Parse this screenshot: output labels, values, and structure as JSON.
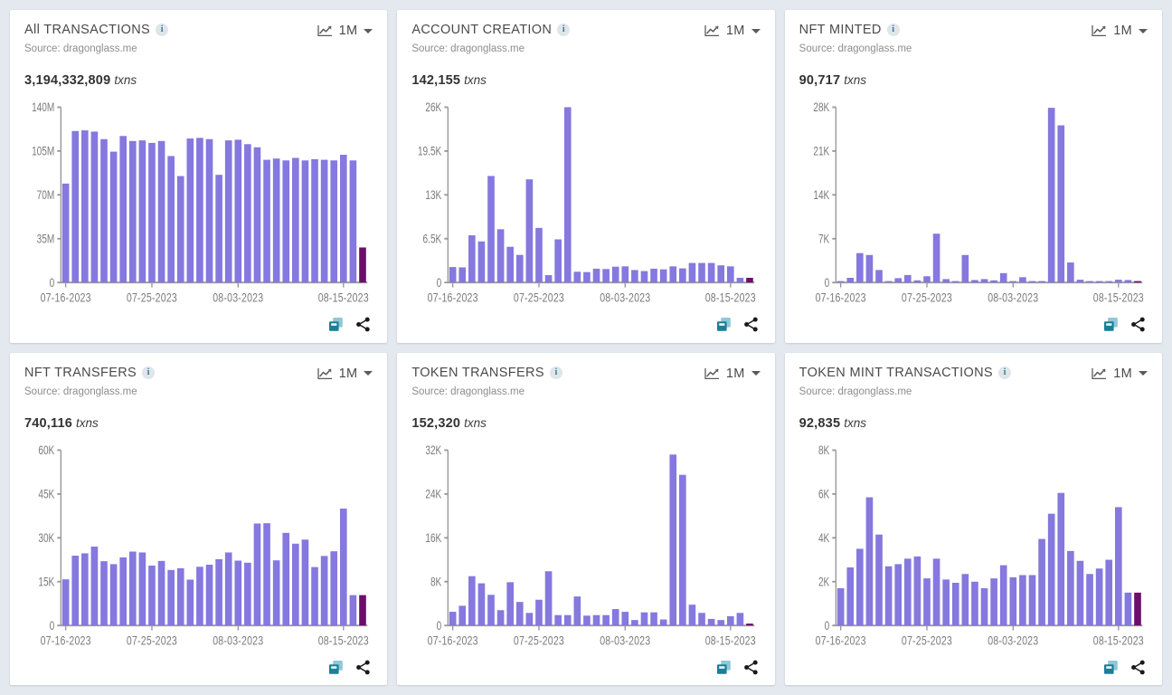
{
  "theme": {
    "page_bg": "#e4e9f0",
    "card_bg": "#ffffff",
    "bar_color": "#8578de",
    "bar_highlight_color": "#6b0f6b",
    "axis_color": "#9a9a9a",
    "tick_text_color": "#7b7b7b",
    "info_icon_color": "#2a7f9e",
    "copy_icon_color": "#1c7f96",
    "share_icon_color": "#1a1a1a"
  },
  "common": {
    "source_label": "Source: dragonglass.me",
    "range_label": "1M",
    "unit_label": "txns",
    "info_glyph": "i",
    "icons": {
      "info": "info-icon",
      "chart_type": "line-chart-icon",
      "dropdown": "chevron-down-icon",
      "copy": "copy-icon",
      "share": "share-icon"
    }
  },
  "cards": [
    {
      "id": "all-transactions",
      "title": "All TRANSACTIONS",
      "source": "Source: dragonglass.me",
      "total": "3,194,332,809",
      "unit": "txns",
      "range": "1M",
      "chart_data": {
        "type": "bar",
        "title": "All TRANSACTIONS",
        "xlabel": "",
        "ylabel": "",
        "ylim": [
          0,
          140000000
        ],
        "yticks": [
          0,
          35000000,
          70000000,
          105000000,
          140000000
        ],
        "ytick_labels": [
          "0",
          "35M",
          "70M",
          "105M",
          "140M"
        ],
        "grid": false,
        "legend": "none",
        "x": [
          "07-16-2023",
          "07-17-2023",
          "07-18-2023",
          "07-19-2023",
          "07-20-2023",
          "07-21-2023",
          "07-22-2023",
          "07-23-2023",
          "07-24-2023",
          "07-25-2023",
          "07-26-2023",
          "07-27-2023",
          "07-28-2023",
          "07-29-2023",
          "07-30-2023",
          "07-31-2023",
          "08-01-2023",
          "08-02-2023",
          "08-03-2023",
          "08-04-2023",
          "08-05-2023",
          "08-06-2023",
          "08-07-2023",
          "08-08-2023",
          "08-09-2023",
          "08-10-2023",
          "08-11-2023",
          "08-12-2023",
          "08-13-2023",
          "08-14-2023",
          "08-15-2023",
          "08-16-2023"
        ],
        "xtick_labels": [
          "07-16-2023",
          "07-25-2023",
          "08-03-2023",
          "08-15-2023"
        ],
        "xtick_indices": [
          0,
          9,
          18,
          29
        ],
        "values": [
          79000000,
          121000000,
          121500000,
          120500000,
          114500000,
          104500000,
          117000000,
          113000000,
          113500000,
          111500000,
          113000000,
          101000000,
          85000000,
          115000000,
          115500000,
          114500000,
          86000000,
          113500000,
          114000000,
          110500000,
          108000000,
          98000000,
          99000000,
          97500000,
          99500000,
          97500000,
          98500000,
          98000000,
          97500000,
          102000000,
          97500000,
          28000000
        ],
        "highlight_index": 31
      }
    },
    {
      "id": "account-creation",
      "title": "ACCOUNT CREATION",
      "source": "Source: dragonglass.me",
      "total": "142,155",
      "unit": "txns",
      "range": "1M",
      "chart_data": {
        "type": "bar",
        "title": "ACCOUNT CREATION",
        "xlabel": "",
        "ylabel": "",
        "ylim": [
          0,
          26000
        ],
        "yticks": [
          0,
          6500,
          13000,
          19500,
          26000
        ],
        "ytick_labels": [
          "0",
          "6.5K",
          "13K",
          "19.5K",
          "26K"
        ],
        "grid": false,
        "legend": "none",
        "x": [
          "07-16-2023",
          "07-17-2023",
          "07-18-2023",
          "07-19-2023",
          "07-20-2023",
          "07-21-2023",
          "07-22-2023",
          "07-23-2023",
          "07-24-2023",
          "07-25-2023",
          "07-26-2023",
          "07-27-2023",
          "07-28-2023",
          "07-29-2023",
          "07-30-2023",
          "07-31-2023",
          "08-01-2023",
          "08-02-2023",
          "08-03-2023",
          "08-04-2023",
          "08-05-2023",
          "08-06-2023",
          "08-07-2023",
          "08-08-2023",
          "08-09-2023",
          "08-10-2023",
          "08-11-2023",
          "08-12-2023",
          "08-13-2023",
          "08-14-2023",
          "08-15-2023",
          "08-16-2023"
        ],
        "xtick_labels": [
          "07-16-2023",
          "07-25-2023",
          "08-03-2023",
          "08-15-2023"
        ],
        "xtick_indices": [
          0,
          9,
          18,
          29
        ],
        "values": [
          2300,
          2250,
          7000,
          6100,
          15800,
          7900,
          5300,
          4100,
          15300,
          8100,
          1100,
          6400,
          26000,
          1600,
          1550,
          2050,
          2000,
          2350,
          2400,
          1850,
          1700,
          2050,
          1950,
          2400,
          2100,
          2900,
          2900,
          2900,
          2550,
          2400,
          700,
          700
        ],
        "highlight_index": 31
      }
    },
    {
      "id": "nft-minted",
      "title": "NFT MINTED",
      "source": "Source: dragonglass.me",
      "total": "90,717",
      "unit": "txns",
      "range": "1M",
      "chart_data": {
        "type": "bar",
        "title": "NFT MINTED",
        "xlabel": "",
        "ylabel": "",
        "ylim": [
          0,
          28000
        ],
        "yticks": [
          0,
          7000,
          14000,
          21000,
          28000
        ],
        "ytick_labels": [
          "0",
          "7K",
          "14K",
          "21K",
          "28K"
        ],
        "grid": false,
        "legend": "none",
        "x": [
          "07-16-2023",
          "07-17-2023",
          "07-18-2023",
          "07-19-2023",
          "07-20-2023",
          "07-21-2023",
          "07-22-2023",
          "07-23-2023",
          "07-24-2023",
          "07-25-2023",
          "07-26-2023",
          "07-27-2023",
          "07-28-2023",
          "07-29-2023",
          "07-30-2023",
          "07-31-2023",
          "08-01-2023",
          "08-02-2023",
          "08-03-2023",
          "08-04-2023",
          "08-05-2023",
          "08-06-2023",
          "08-07-2023",
          "08-08-2023",
          "08-09-2023",
          "08-10-2023",
          "08-11-2023",
          "08-12-2023",
          "08-13-2023",
          "08-14-2023",
          "08-15-2023",
          "08-16-2023"
        ],
        "xtick_labels": [
          "07-16-2023",
          "07-25-2023",
          "08-03-2023",
          "08-15-2023"
        ],
        "xtick_indices": [
          0,
          9,
          18,
          29
        ],
        "values": [
          60,
          750,
          4700,
          4400,
          2000,
          100,
          700,
          1200,
          350,
          1000,
          7800,
          550,
          120,
          4400,
          400,
          550,
          350,
          1500,
          120,
          850,
          80,
          60,
          27900,
          25100,
          3200,
          450,
          80,
          80,
          100,
          450,
          400,
          60
        ],
        "highlight_index": 31
      }
    },
    {
      "id": "nft-transfers",
      "title": "NFT TRANSFERS",
      "source": "Source: dragonglass.me",
      "total": "740,116",
      "unit": "txns",
      "range": "1M",
      "chart_data": {
        "type": "bar",
        "title": "NFT TRANSFERS",
        "xlabel": "",
        "ylabel": "",
        "ylim": [
          0,
          60000
        ],
        "yticks": [
          0,
          15000,
          30000,
          45000,
          60000
        ],
        "ytick_labels": [
          "0",
          "15K",
          "30K",
          "45K",
          "60K"
        ],
        "grid": false,
        "legend": "none",
        "x": [
          "07-16-2023",
          "07-17-2023",
          "07-18-2023",
          "07-19-2023",
          "07-20-2023",
          "07-21-2023",
          "07-22-2023",
          "07-23-2023",
          "07-24-2023",
          "07-25-2023",
          "07-26-2023",
          "07-27-2023",
          "07-28-2023",
          "07-29-2023",
          "07-30-2023",
          "07-31-2023",
          "08-01-2023",
          "08-02-2023",
          "08-03-2023",
          "08-04-2023",
          "08-05-2023",
          "08-06-2023",
          "08-07-2023",
          "08-08-2023",
          "08-09-2023",
          "08-10-2023",
          "08-11-2023",
          "08-12-2023",
          "08-13-2023",
          "08-14-2023",
          "08-15-2023",
          "08-16-2023"
        ],
        "xtick_labels": [
          "07-16-2023",
          "07-25-2023",
          "08-03-2023",
          "08-15-2023"
        ],
        "xtick_indices": [
          0,
          9,
          18,
          29
        ],
        "values": [
          15800,
          23900,
          24700,
          27000,
          22000,
          21000,
          23300,
          25300,
          25000,
          20500,
          22100,
          19000,
          19600,
          15700,
          20100,
          20800,
          22700,
          25000,
          22200,
          21500,
          34900,
          35000,
          22300,
          31700,
          28000,
          29400,
          20000,
          23800,
          25400,
          40000,
          10400,
          10400
        ],
        "highlight_index": 31
      }
    },
    {
      "id": "token-transfers",
      "title": "TOKEN TRANSFERS",
      "source": "Source: dragonglass.me",
      "total": "152,320",
      "unit": "txns",
      "range": "1M",
      "chart_data": {
        "type": "bar",
        "title": "TOKEN TRANSFERS",
        "xlabel": "",
        "ylabel": "",
        "ylim": [
          0,
          32000
        ],
        "yticks": [
          0,
          8000,
          16000,
          24000,
          32000
        ],
        "ytick_labels": [
          "0",
          "8K",
          "16K",
          "24K",
          "32K"
        ],
        "grid": false,
        "legend": "none",
        "x": [
          "07-16-2023",
          "07-17-2023",
          "07-18-2023",
          "07-19-2023",
          "07-20-2023",
          "07-21-2023",
          "07-22-2023",
          "07-23-2023",
          "07-24-2023",
          "07-25-2023",
          "07-26-2023",
          "07-27-2023",
          "07-28-2023",
          "07-29-2023",
          "07-30-2023",
          "07-31-2023",
          "08-01-2023",
          "08-02-2023",
          "08-03-2023",
          "08-04-2023",
          "08-05-2023",
          "08-06-2023",
          "08-07-2023",
          "08-08-2023",
          "08-09-2023",
          "08-10-2023",
          "08-11-2023",
          "08-12-2023",
          "08-13-2023",
          "08-14-2023",
          "08-15-2023",
          "08-16-2023"
        ],
        "xtick_labels": [
          "07-16-2023",
          "07-25-2023",
          "08-03-2023",
          "08-15-2023"
        ],
        "xtick_indices": [
          0,
          9,
          18,
          29
        ],
        "values": [
          2500,
          3600,
          9000,
          7700,
          5600,
          2800,
          7900,
          4300,
          2300,
          4700,
          9900,
          1900,
          1900,
          5300,
          1800,
          1900,
          1900,
          3000,
          2500,
          1000,
          2400,
          2400,
          1100,
          31200,
          27500,
          3800,
          2300,
          1200,
          1000,
          1700,
          2300,
          350
        ],
        "highlight_index": 31
      }
    },
    {
      "id": "token-mint-transactions",
      "title": "TOKEN MINT TRANSACTIONS",
      "source": "Source: dragonglass.me",
      "total": "92,835",
      "unit": "txns",
      "range": "1M",
      "chart_data": {
        "type": "bar",
        "title": "TOKEN MINT TRANSACTIONS",
        "xlabel": "",
        "ylabel": "",
        "ylim": [
          0,
          8000
        ],
        "yticks": [
          0,
          2000,
          4000,
          6000,
          8000
        ],
        "ytick_labels": [
          "0",
          "2K",
          "4K",
          "6K",
          "8K"
        ],
        "grid": false,
        "legend": "none",
        "x": [
          "07-16-2023",
          "07-17-2023",
          "07-18-2023",
          "07-19-2023",
          "07-20-2023",
          "07-21-2023",
          "07-22-2023",
          "07-23-2023",
          "07-24-2023",
          "07-25-2023",
          "07-26-2023",
          "07-27-2023",
          "07-28-2023",
          "07-29-2023",
          "07-30-2023",
          "07-31-2023",
          "08-01-2023",
          "08-02-2023",
          "08-03-2023",
          "08-04-2023",
          "08-05-2023",
          "08-06-2023",
          "08-07-2023",
          "08-08-2023",
          "08-09-2023",
          "08-10-2023",
          "08-11-2023",
          "08-12-2023",
          "08-13-2023",
          "08-14-2023",
          "08-15-2023",
          "08-16-2023"
        ],
        "xtick_labels": [
          "07-16-2023",
          "07-25-2023",
          "08-03-2023",
          "08-15-2023"
        ],
        "xtick_indices": [
          0,
          9,
          18,
          29
        ],
        "values": [
          1700,
          2650,
          3500,
          5850,
          4150,
          2700,
          2800,
          3050,
          3150,
          2150,
          3050,
          2100,
          1950,
          2350,
          2000,
          1700,
          2150,
          2750,
          2200,
          2300,
          2300,
          3950,
          5100,
          6050,
          3400,
          2950,
          2350,
          2600,
          3000,
          5400,
          1500,
          1500
        ],
        "highlight_index": 31
      }
    }
  ]
}
